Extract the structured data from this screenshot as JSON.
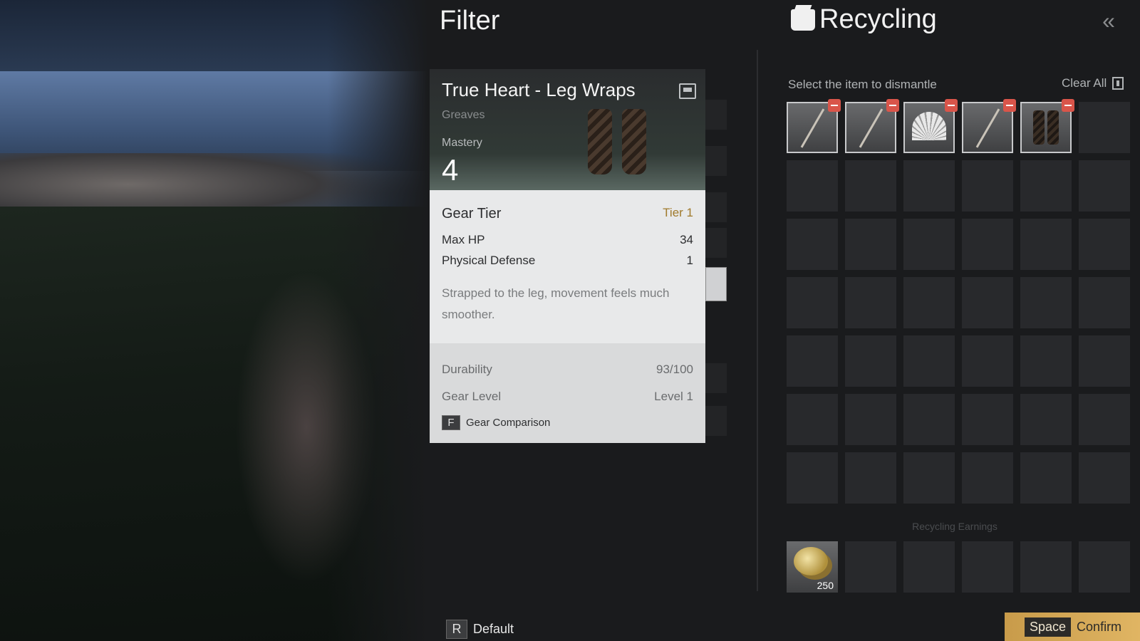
{
  "filter": {
    "title": "Filter",
    "default_key": "R",
    "default_label": "Default"
  },
  "item_card": {
    "name": "True Heart - Leg Wraps",
    "type": "Greaves",
    "mastery_label": "Mastery",
    "mastery_value": "4",
    "gear_tier_label": "Gear Tier",
    "gear_tier_value": "Tier 1",
    "stats": [
      {
        "label": "Max HP",
        "value": "34"
      },
      {
        "label": "Physical Defense",
        "value": "1"
      }
    ],
    "description": "Strapped to the leg, movement feels much smoother.",
    "durability_label": "Durability",
    "durability_value": "93/100",
    "gear_level_label": "Gear Level",
    "gear_level_value": "Level 1",
    "comparison_key": "F",
    "comparison_label": "Gear Comparison"
  },
  "recycling": {
    "title": "Recycling",
    "select_hint": "Select the item to dismantle",
    "clear_all": "Clear All",
    "selected_items": [
      "spear-icon",
      "spear-icon",
      "fan-icon",
      "spear-icon",
      "leg-wraps-icon"
    ],
    "earnings_label": "Recycling Earnings",
    "earnings": [
      {
        "icon": "coins-icon",
        "quantity": "250"
      }
    ],
    "confirm_key": "Space",
    "confirm_label": "Confirm"
  },
  "colors": {
    "accent_gold": "#e0b563",
    "remove_red": "#d9554a",
    "tier_text": "#a07a2c"
  }
}
